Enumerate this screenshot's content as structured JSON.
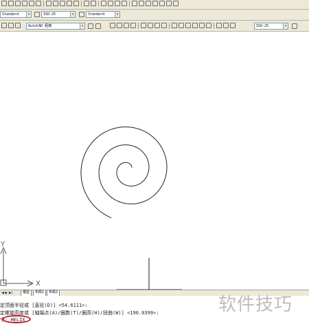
{
  "toolbars": {
    "text_style": "Standard",
    "dim_style": "ISO-25",
    "table_style": "Standard",
    "workspace": "AutoCAD 经典",
    "dim_style_2": "ISO-25"
  },
  "drawing": {
    "axis_y_label": "Y",
    "axis_x_label": "X"
  },
  "tabs": {
    "nav_buttons": "◀ ▶ ▶|",
    "model": "模型",
    "layout1": "布局1",
    "layout2": "布局2"
  },
  "command": {
    "line1": "定顶面半径或 [直径(D)] <54.6111>:",
    "line2": "定螺旋高度或 [轴端点(A)/圈数(T)/圈高(H)/扭曲(W)] <190.0399>:",
    "prompt_prefix": "令:",
    "input": "HELIX"
  },
  "watermark": "软件技巧",
  "colors": {
    "highlight": "#c8102e"
  }
}
